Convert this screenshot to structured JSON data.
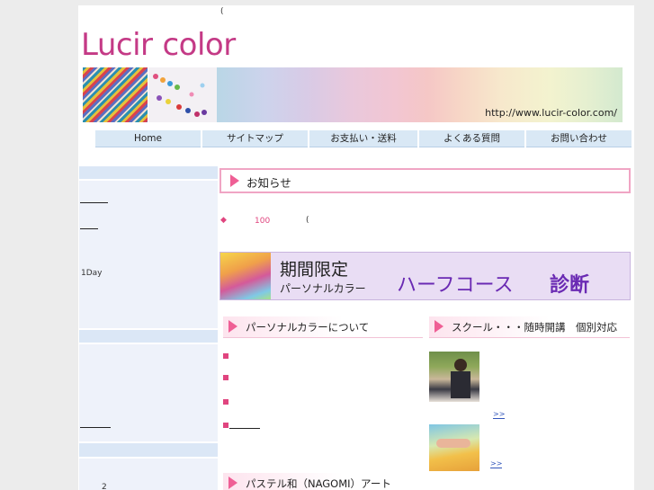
{
  "header": {
    "top_mark": "(",
    "logo_main": "Lucir",
    "logo_sub": "color",
    "url": "http://www.lucir-color.com/"
  },
  "nav": {
    "items": [
      "Home",
      "サイトマップ",
      "お支払い・送料",
      "よくある質問",
      "お問い合わせ"
    ]
  },
  "sidebar": {
    "oneday": "1Day",
    "num": "2"
  },
  "news": {
    "title": "お知らせ",
    "diamond": "◆",
    "count": "100",
    "paren": "("
  },
  "promo": {
    "title": "期間限定",
    "sub": "パーソナルカラー",
    "course": "ハーフコース",
    "diag": "診断"
  },
  "sections": {
    "personal_color": "パーソナルカラーについて",
    "school": "スクール・・・随時開講　個別対応",
    "pastel": "パステル和（NAGOMI）アート",
    "more1": ">>",
    "more2": ">>"
  },
  "colors": {
    "accent": "#ef5f95",
    "logo": "#c43a86",
    "nav_bg": "#d9e8f5",
    "sidebar_bg": "#eef2fa"
  }
}
